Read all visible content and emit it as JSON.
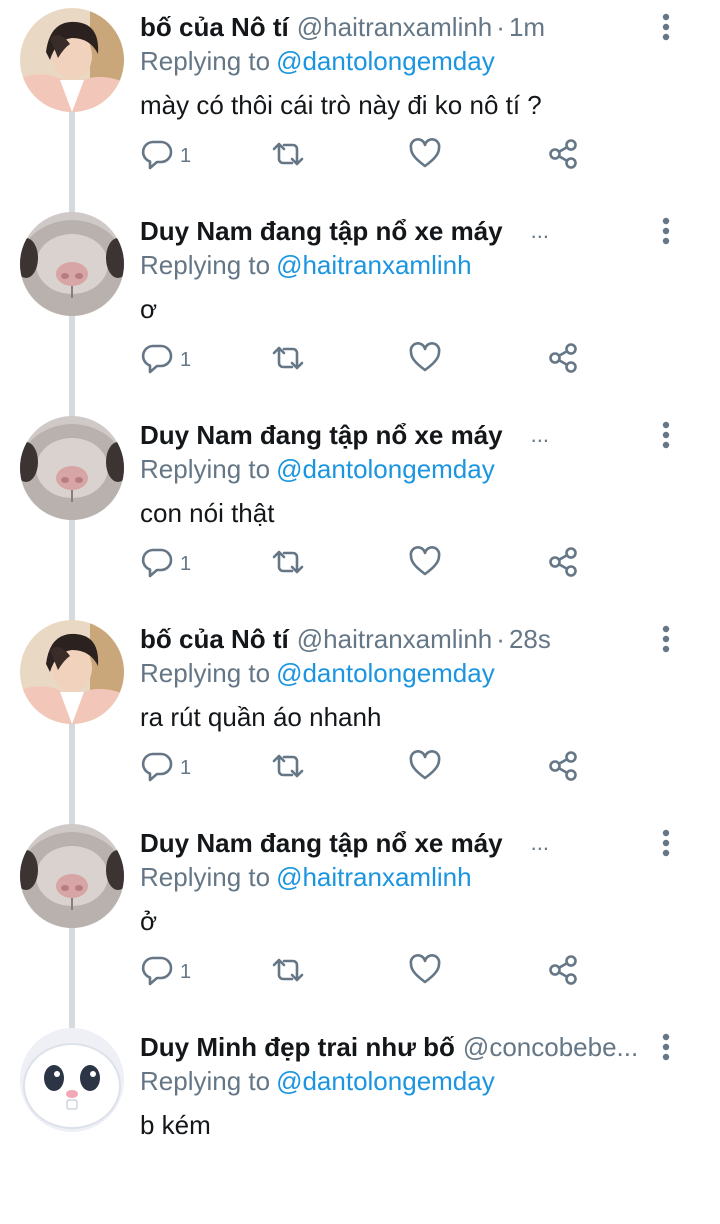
{
  "reply_prefix": "Replying to",
  "tweets": [
    {
      "name": "bố của Nô tí",
      "handle": "@haitranxamlinh",
      "sep": "·",
      "time": "1m",
      "trunc": "",
      "reply_to": "@dantolongemday",
      "text": "mày có thôi cái trò này đi ko nô tí ?",
      "reply_count": "1",
      "avatar": "boy-avatar"
    },
    {
      "name": "Duy Nam đang tập nổ xe máy",
      "handle": "",
      "sep": "",
      "time": "",
      "trunc": "...",
      "reply_to": "@haitranxamlinh",
      "text": "ơ",
      "reply_count": "1",
      "avatar": "hamster-avatar"
    },
    {
      "name": "Duy Nam đang tập nổ xe máy",
      "handle": "",
      "sep": "",
      "time": "",
      "trunc": "...",
      "reply_to": "@dantolongemday",
      "text": "con nói thật",
      "reply_count": "1",
      "avatar": "hamster-avatar"
    },
    {
      "name": "bố của Nô tí",
      "handle": "@haitranxamlinh",
      "sep": "·",
      "time": "28s",
      "trunc": "",
      "reply_to": "@dantolongemday",
      "text": "ra rút quần áo nhanh",
      "reply_count": "1",
      "avatar": "boy-avatar"
    },
    {
      "name": "Duy Nam đang tập nổ xe máy",
      "handle": "",
      "sep": "",
      "time": "",
      "trunc": "...",
      "reply_to": "@haitranxamlinh",
      "text": "ở",
      "reply_count": "1",
      "avatar": "hamster-avatar"
    },
    {
      "name": "Duy Minh đẹp trai như bố",
      "handle": "@concobebe...",
      "sep": "",
      "time": "",
      "trunc": "",
      "reply_to": "@dantolongemday",
      "text": "b kém",
      "reply_count": "",
      "avatar": "bunny-avatar"
    }
  ],
  "colors": {
    "accent": "#1b95e0",
    "muted": "#657786",
    "text": "#14171a",
    "thread_line": "#d5dade"
  },
  "icons": [
    "reply-icon",
    "retweet-icon",
    "like-icon",
    "share-icon",
    "more-icon"
  ]
}
